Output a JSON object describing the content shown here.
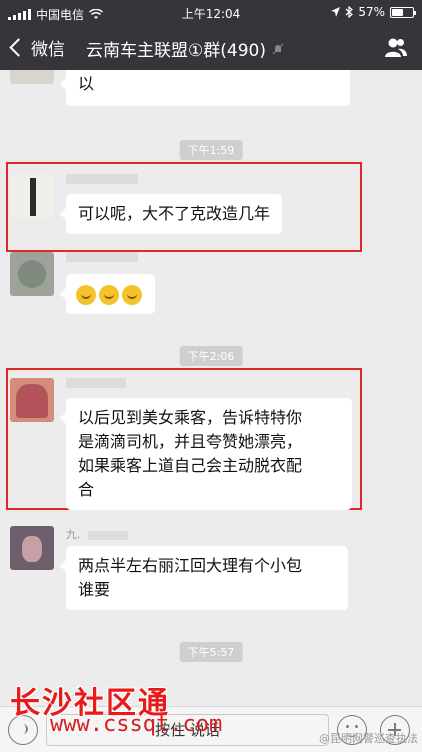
{
  "status_bar": {
    "carrier": "中国电信",
    "time": "上午12:04",
    "battery": "57%",
    "battery_level": 0.57
  },
  "nav": {
    "back_label": "微信",
    "title": "云南车主联盟①群(490)"
  },
  "chat": {
    "messages": [
      {
        "text": "以"
      },
      {
        "time": "下午1:59"
      },
      {
        "text": "可以呢，大不了克改造几年"
      },
      {
        "emoji_count": 3
      },
      {
        "time": "下午2:06"
      },
      {
        "lines": [
          "以后见到美女乘客，告诉特特你",
          "是滴滴司机，并且夸赞她漂亮，",
          "如果乘客上道自己会主动脱衣配",
          "合"
        ]
      },
      {
        "nick": "九.",
        "lines": [
          "两点半左右丽江回大理有个小包",
          "谁要"
        ]
      },
      {
        "time": "下午5:57"
      }
    ]
  },
  "input_bar": {
    "hold_to_talk": "按住 说话"
  },
  "watermarks": {
    "brand": "长沙社区通",
    "url": "www.cssqt.com",
    "weibo": "@昆明网警巡查执法"
  },
  "colors": {
    "navbar": "#36363a",
    "chat_bg": "#ececec",
    "highlight_box": "#e02828"
  }
}
